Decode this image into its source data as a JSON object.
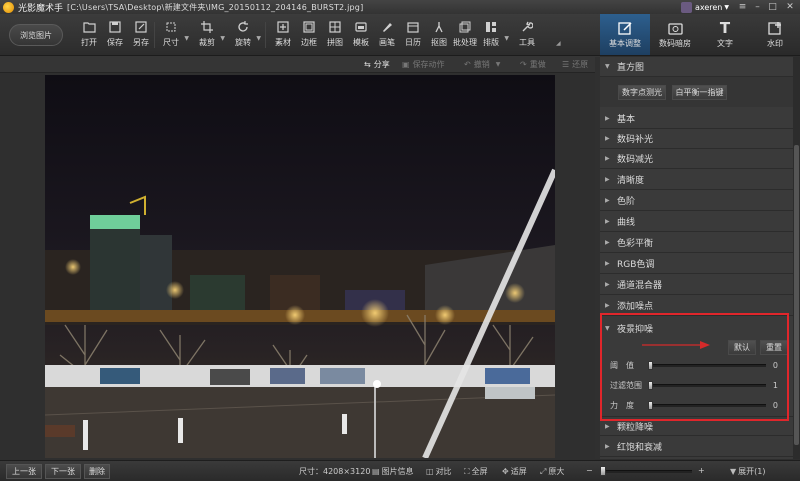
{
  "titlebar": {
    "app": "光影魔术手",
    "path": "[C:\\Users\\TSA\\Desktop\\新建文件夹\\IMG_20150112_204146_BURST2.jpg]",
    "user": "axeren",
    "min": "–",
    "max": "□",
    "close": "✕"
  },
  "toolbar": {
    "browse": "浏览图片",
    "items": [
      {
        "label": "打开",
        "icon": "open-icon"
      },
      {
        "label": "保存",
        "icon": "save-icon"
      },
      {
        "label": "另存",
        "icon": "save-as-icon"
      },
      {
        "label": "尺寸",
        "icon": "resize-icon"
      },
      {
        "label": "裁剪",
        "icon": "crop-icon"
      },
      {
        "label": "旋转",
        "icon": "rotate-icon"
      },
      {
        "label": "素材",
        "icon": "material-icon"
      },
      {
        "label": "边框",
        "icon": "border-icon"
      },
      {
        "label": "拼图",
        "icon": "collage-icon"
      },
      {
        "label": "模板",
        "icon": "template-icon"
      },
      {
        "label": "画笔",
        "icon": "brush-icon"
      },
      {
        "label": "日历",
        "icon": "calendar-icon"
      },
      {
        "label": "抠图",
        "icon": "cutout-icon"
      },
      {
        "label": "批处理",
        "icon": "batch-icon"
      },
      {
        "label": "排版",
        "icon": "layout-icon"
      },
      {
        "label": "工具",
        "icon": "tools-icon"
      }
    ]
  },
  "rtabs": [
    {
      "label": "基本调整",
      "icon": "edit-icon",
      "active": true
    },
    {
      "label": "数码暗房",
      "icon": "camera-icon",
      "active": false
    },
    {
      "label": "文字",
      "icon": "text-icon",
      "active": false
    },
    {
      "label": "水印",
      "icon": "watermark-icon",
      "active": false
    }
  ],
  "actions": {
    "share": "分享",
    "save_action": "保存动作",
    "undo": "撤销",
    "redo": "重做",
    "restore": "还原"
  },
  "panel": {
    "histogram": "直方图",
    "digital_metering": "数字点测光",
    "white_balance": "白平衡一指键",
    "sections_top": [
      "基本",
      "数码补光",
      "数码减光",
      "清晰度",
      "色阶",
      "曲线",
      "色彩平衡",
      "RGB色调",
      "通道混合器",
      "添加噪点"
    ],
    "night_denoise": {
      "title": "夜景抑噪",
      "default_btn": "默认",
      "reset_btn": "重置",
      "sliders": [
        {
          "label": "阈　值",
          "value": 0,
          "fraction": 0.0
        },
        {
          "label": "过滤范围",
          "value": 1,
          "fraction": 0.0
        },
        {
          "label": "力　度",
          "value": 0,
          "fraction": 0.0
        }
      ]
    },
    "sections_bottom": [
      "颗粒降噪",
      "红饱和衰减"
    ]
  },
  "status": {
    "prev": "上一张",
    "next": "下一张",
    "delete": "删除",
    "size": "尺寸：4208×3120",
    "info": "图片信息",
    "compare": "对比",
    "fullscreen": "全屏",
    "fit": "适屏",
    "original": "原大",
    "zoom_minus": "−",
    "zoom_plus": "+",
    "zoom_fraction": 0.0,
    "expand": "展开(1)"
  },
  "colors": {
    "accent": "#2d5f8e",
    "highlight": "#e0262b",
    "arrow": "#d42a2a"
  }
}
